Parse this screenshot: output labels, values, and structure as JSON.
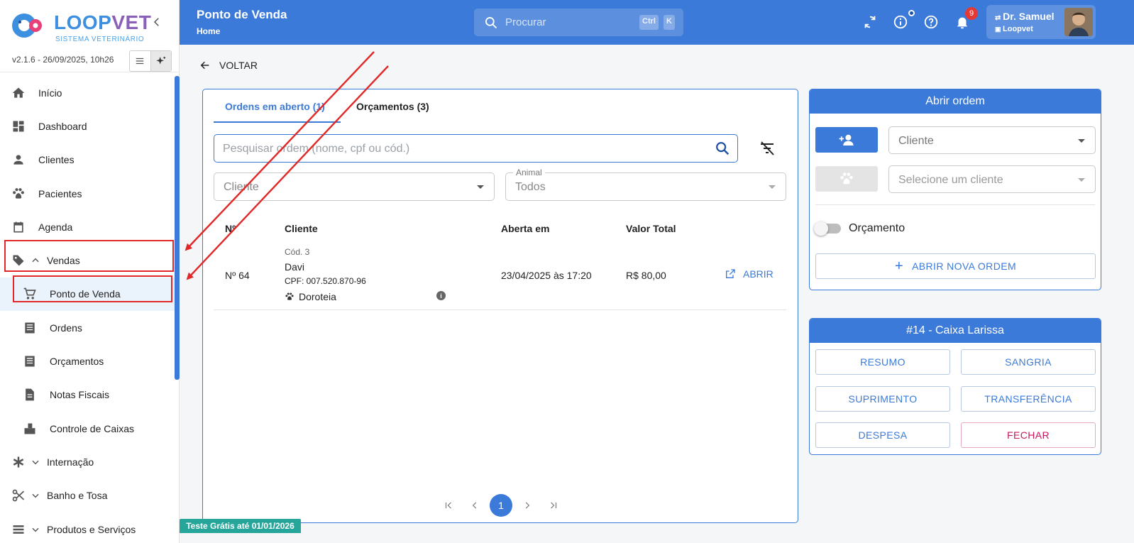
{
  "brand": {
    "name_part1": "LOOP",
    "name_part2": "VET",
    "subtitle": "SISTEMA VETERINÁRIO",
    "version": "v2.1.6 - 26/09/2025, 10h26"
  },
  "sidebar": {
    "items": [
      {
        "label": "Início",
        "icon": "home-icon"
      },
      {
        "label": "Dashboard",
        "icon": "dashboard-icon"
      },
      {
        "label": "Clientes",
        "icon": "person-icon"
      },
      {
        "label": "Pacientes",
        "icon": "paw-icon"
      },
      {
        "label": "Agenda",
        "icon": "calendar-icon"
      },
      {
        "label": "Vendas",
        "icon": "tag-icon",
        "expanded": true
      },
      {
        "label": "Ponto de Venda",
        "icon": "cart-icon",
        "selected": true
      },
      {
        "label": "Ordens",
        "icon": "list-icon"
      },
      {
        "label": "Orçamentos",
        "icon": "list-icon"
      },
      {
        "label": "Notas Fiscais",
        "icon": "document-icon"
      },
      {
        "label": "Controle de Caixas",
        "icon": "cash-register-icon"
      },
      {
        "label": "Internação",
        "icon": "asterisk-icon"
      },
      {
        "label": "Banho e Tosa",
        "icon": "scissors-icon"
      },
      {
        "label": "Produtos e Serviços",
        "icon": "stack-icon"
      }
    ]
  },
  "header": {
    "title": "Ponto de Venda",
    "breadcrumb": "Home",
    "search_placeholder": "Procurar",
    "shortcut_ctrl": "Ctrl",
    "shortcut_k": "K",
    "notification_count": "9",
    "user_name": "Dr. Samuel",
    "user_org": "Loopvet"
  },
  "back_label": "VOLTAR",
  "orders": {
    "tabs": [
      {
        "label": "Ordens em aberto (1)",
        "active": true
      },
      {
        "label": "Orçamentos (3)",
        "active": false
      }
    ],
    "search_placeholder": "Pesquisar ordem (nome, cpf ou cód.)",
    "client_filter": "Cliente",
    "animal_filter_label": "Animal",
    "animal_filter_value": "Todos",
    "columns": [
      "Nº",
      "Cliente",
      "Aberta em",
      "Valor Total"
    ],
    "rows": [
      {
        "number": "Nº 64",
        "code": "Cód. 3",
        "client": "Davi",
        "cpf": "CPF: 007.520.870-96",
        "pet": "Doroteia",
        "opened_at": "23/04/2025 às 17:20",
        "total": "R$ 80,00",
        "action": "ABRIR"
      }
    ],
    "current_page": "1"
  },
  "open_order": {
    "title": "Abrir ordem",
    "client_placeholder": "Cliente",
    "pet_placeholder": "Selecione um cliente",
    "budget_toggle_label": "Orçamento",
    "budget_toggle_on": false,
    "submit_label": "ABRIR NOVA ORDEM"
  },
  "cash_register": {
    "title": "#14 - Caixa Larissa",
    "actions": [
      "RESUMO",
      "SANGRIA",
      "SUPRIMENTO",
      "TRANSFERÊNCIA",
      "DESPESA",
      "FECHAR"
    ]
  },
  "trial_badge": "Teste Grátis até 01/01/2026",
  "colors": {
    "primary": "#3b7ad9",
    "annotation": "#e12828",
    "danger": "#c2185b",
    "badge": "#26a69a"
  }
}
